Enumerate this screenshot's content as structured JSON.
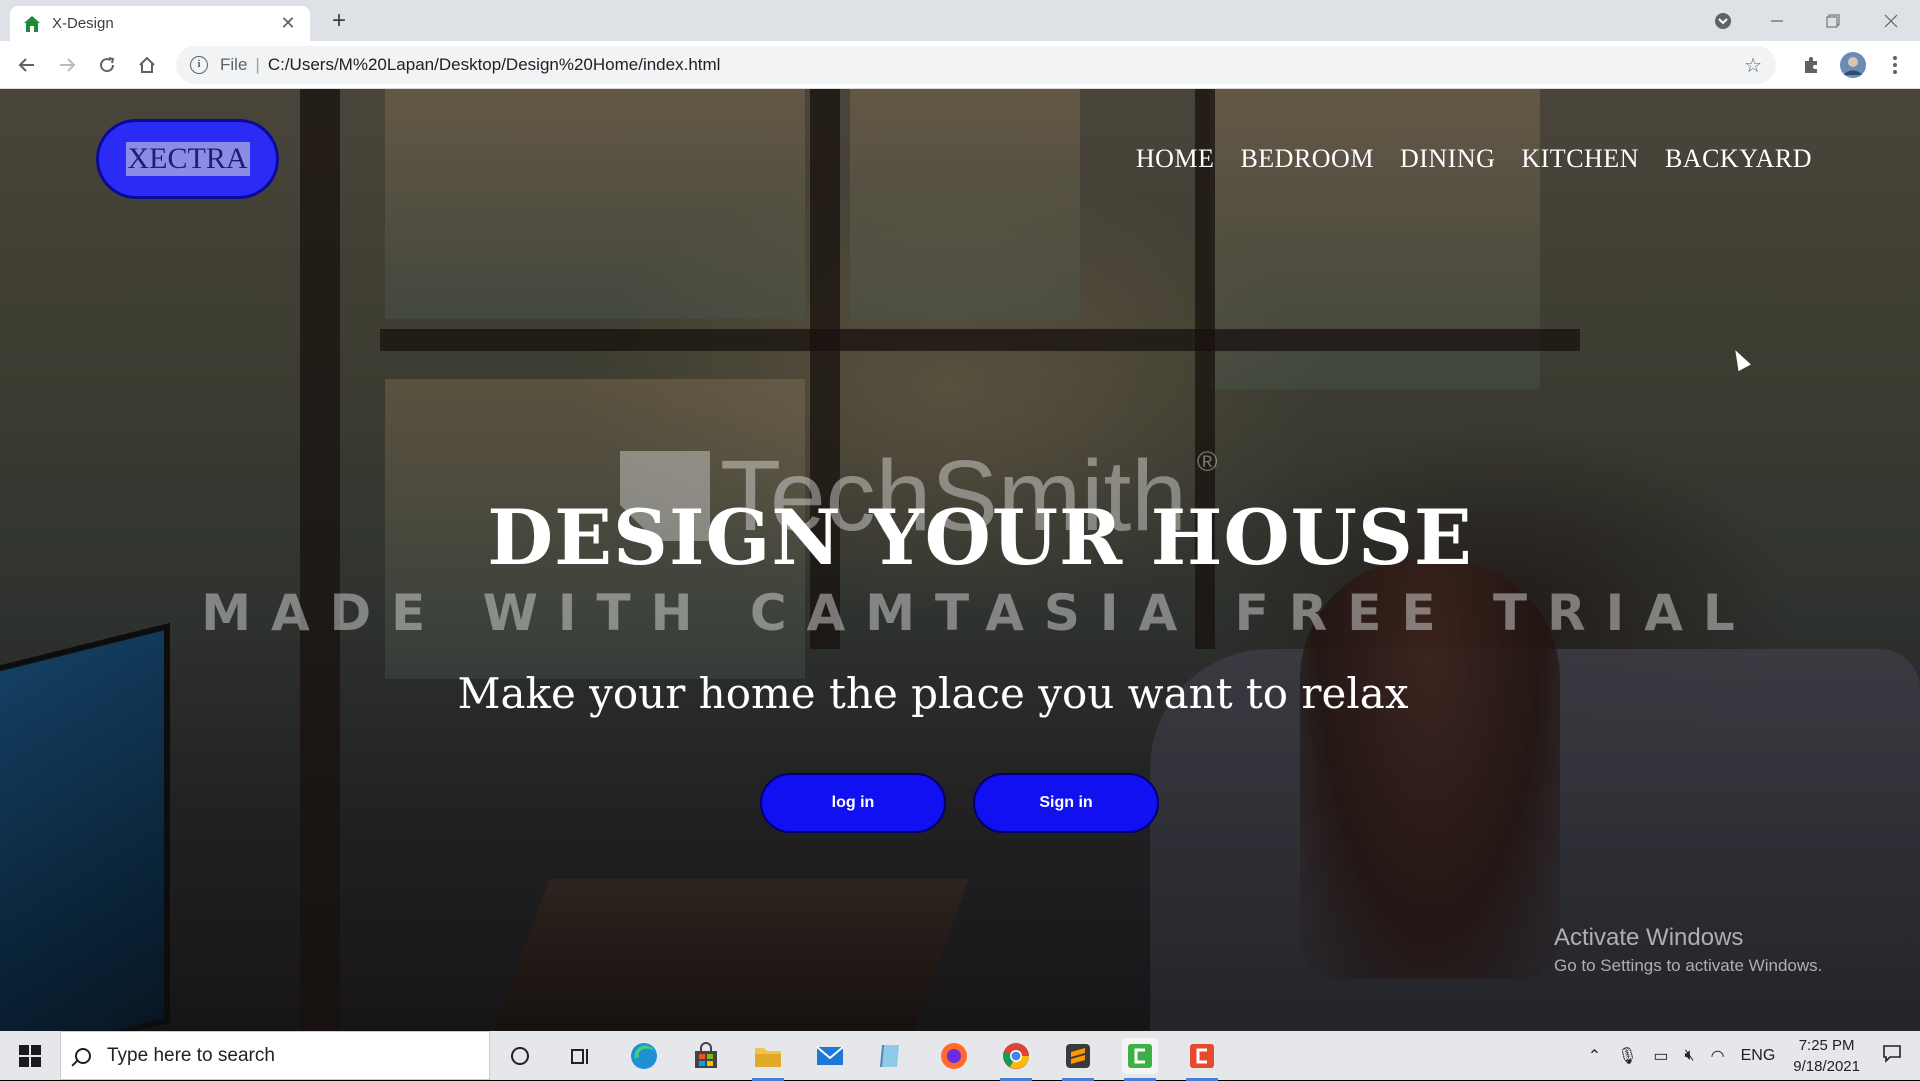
{
  "browser": {
    "tab_title": "X-Design",
    "tab_close": "✕",
    "new_tab": "+",
    "address_scheme": "File",
    "address_url": "C:/Users/M%20Lapan/Desktop/Design%20Home/index.html"
  },
  "page": {
    "logo_text": "XECTRA",
    "nav": [
      {
        "label": "HOME"
      },
      {
        "label": "BEDROOM"
      },
      {
        "label": "DINING"
      },
      {
        "label": "KITCHEN"
      },
      {
        "label": "BACKYARD"
      }
    ],
    "hero_title": "DESIGN YOUR HOUSE",
    "hero_subtitle": "Make your home the place you want to relax",
    "login_label": "log in",
    "signin_label": "Sign in"
  },
  "watermark": {
    "brand": "TechSmith",
    "reg": "®",
    "line": "MADE WITH CAMTASIA FREE TRIAL"
  },
  "activation": {
    "title": "Activate Windows",
    "subtitle": "Go to Settings to activate Windows."
  },
  "taskbar": {
    "search_placeholder": "Type here to search",
    "language": "ENG",
    "time": "7:25 PM",
    "date": "9/18/2021"
  },
  "colors": {
    "button_blue": "#1010f0",
    "logo_blue": "#2b2bf5"
  }
}
